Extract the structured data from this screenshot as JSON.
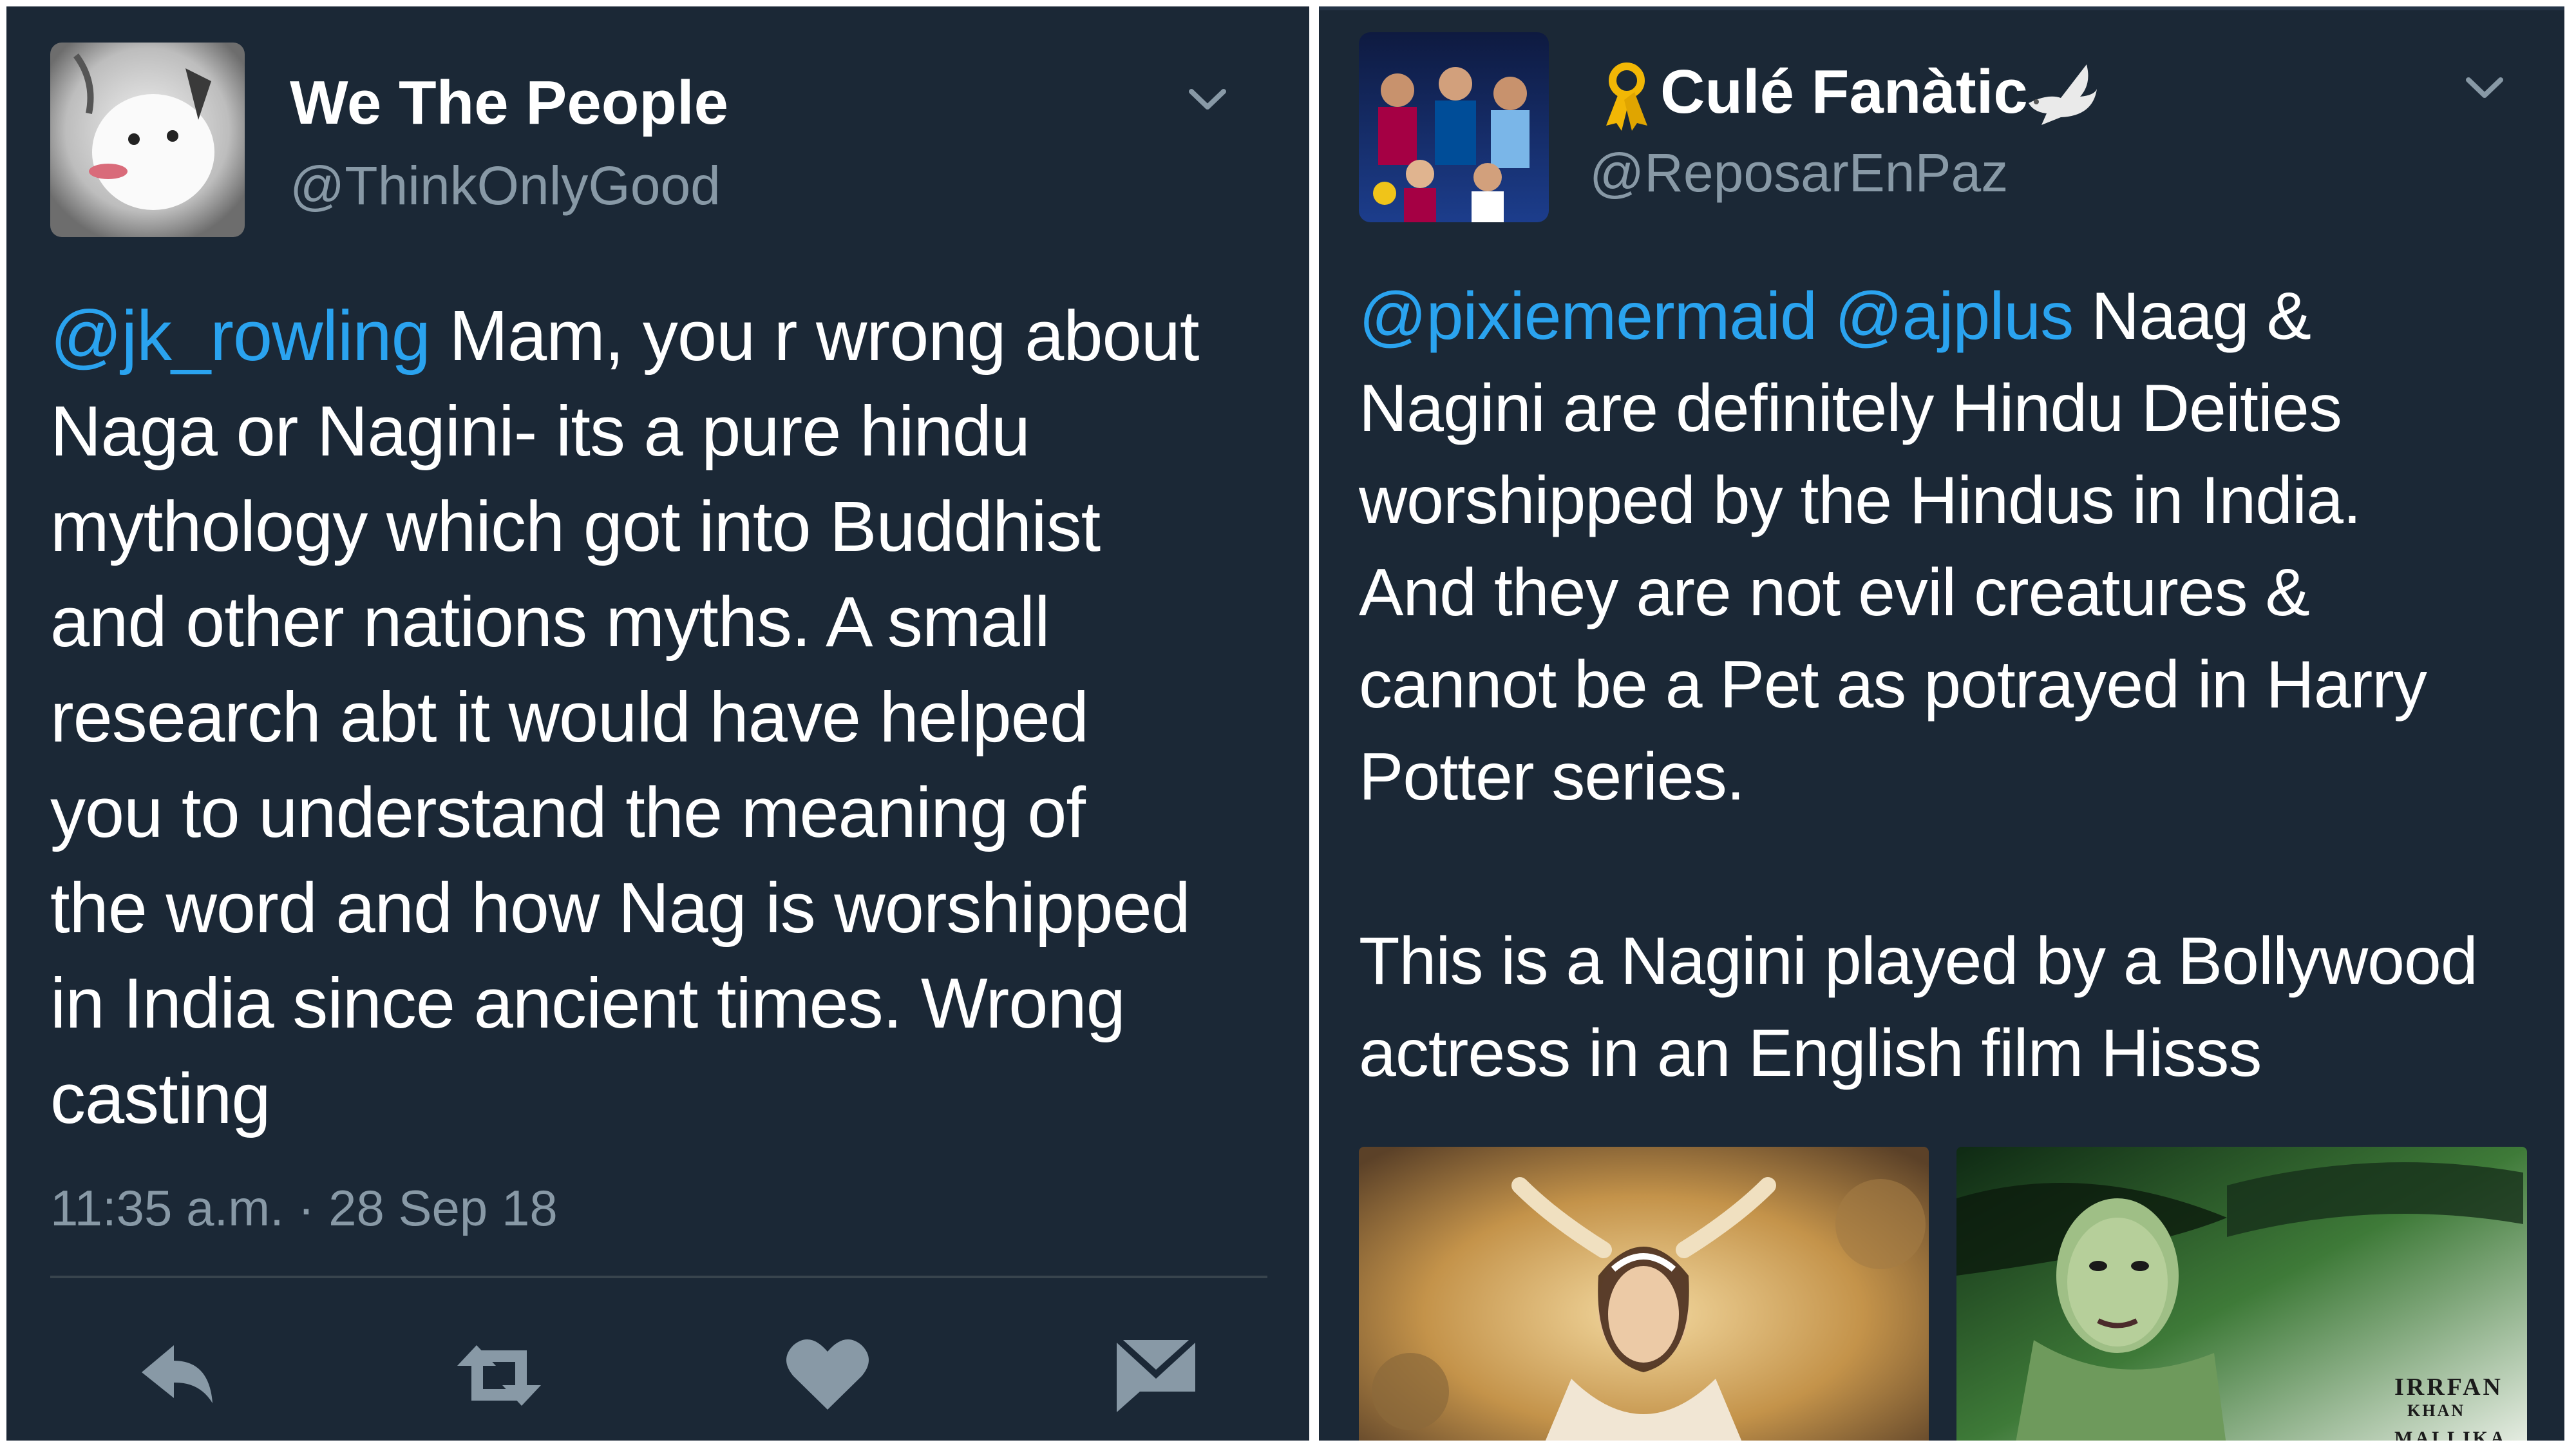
{
  "left_tweet": {
    "display_name": "We The People",
    "handle": "@ThinkOnlyGood",
    "mention": "@jk_rowling",
    "text": " Mam, you r wrong about\nNaga or Nagini- its a pure hindu\nmythology which got into Buddhist\nand other nations myths. A small\nresearch abt it would have helped\nyou to understand the meaning of\nthe word and how Nag is worshipped\nin India since ancient times. Wrong\ncasting",
    "timestamp": "11:35 a.m. · 28 Sep 18",
    "actions": [
      "reply-icon",
      "retweet-icon",
      "like-icon",
      "message-icon"
    ]
  },
  "right_tweet": {
    "display_name": "Culé Fanàtic",
    "handle": "@ReposarEnPaz",
    "mention_1": "@pixiemermaid",
    "mention_2": "@ajplus",
    "text": " Naag &\nNagini are definitely Hindu Deities\nworshipped by the Hindus in India.\nAnd they are not evil creatures &\ncannot be a Pet as potrayed in Harry\nPotter series.\n\nThis is a Nagini played by a Bollywood\nactress in an English film Hisss",
    "poster_text_line1": "IRRFAN",
    "poster_text_line2": "KHAN",
    "poster_text_line3": "MALLIKA"
  },
  "colors": {
    "background": "#1b2836",
    "text": "#ffffff",
    "secondary": "#8899a6",
    "link": "#2aa3ef",
    "divider": "#38444d"
  }
}
